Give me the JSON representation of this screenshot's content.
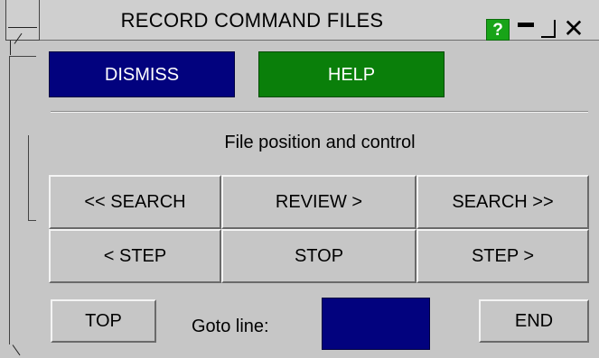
{
  "window": {
    "title": "RECORD COMMAND FILES",
    "help_glyph": "?",
    "close_glyph": "✕",
    "help_color": "#18a418"
  },
  "top_buttons": {
    "dismiss": "DISMISS",
    "help": "HELP",
    "dismiss_color": "#02027e",
    "help_color": "#0a7f0a"
  },
  "section": {
    "title": "File position and control"
  },
  "controls": {
    "search_back": "<< SEARCH",
    "review": "REVIEW >",
    "search_forward": "SEARCH >>",
    "step_back": "< STEP",
    "stop": "STOP",
    "step_forward": "STEP >"
  },
  "bottom": {
    "top": "TOP",
    "goto_label": "Goto line:",
    "goto_value": "",
    "end": "END"
  }
}
